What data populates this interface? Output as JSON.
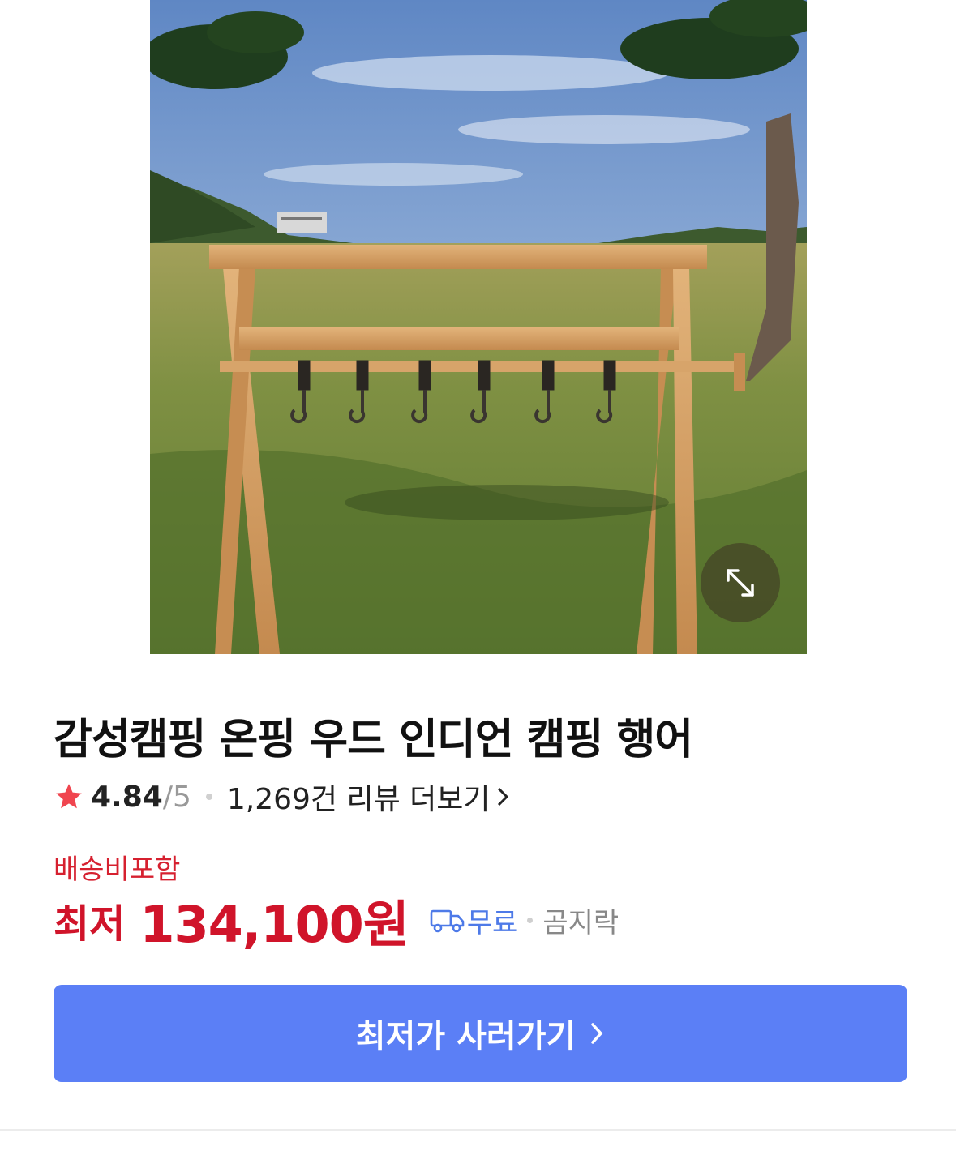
{
  "product": {
    "image_alt": "wooden camping hanger rack with six hooks on grass field",
    "title": "감성캠핑 온핑 우드 인디언 캠핑 행어",
    "rating": "4.84",
    "rating_max": "/5",
    "reviews_link": "1,269건 리뷰 더보기",
    "shipping_included": "배송비포함",
    "price_prefix": "최저",
    "price": "134,100원",
    "shipping_fee": "무료",
    "seller": "곰지락"
  },
  "actions": {
    "buy_label": "최저가 사러가기"
  },
  "icons": {
    "zoom": "expand-arrows-icon",
    "star": "star-icon",
    "truck": "truck-icon",
    "chevron": "chevron-right-icon"
  },
  "colors": {
    "price_red": "#d0142a",
    "accent_blue": "#5b7ff6",
    "star_red": "#f0454f"
  }
}
